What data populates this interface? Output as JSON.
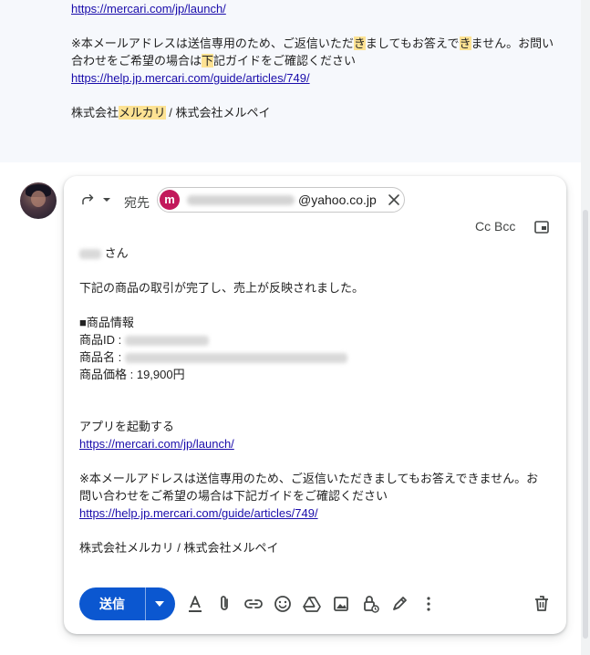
{
  "quoted": {
    "link1": "https://mercari.com/jp/launch/",
    "notice_a": "※本メールアドレスは送信専用のため、ご返信いただ",
    "notice_hl1": "き",
    "notice_b": "ましてもお答えで",
    "notice_hl2": "き",
    "notice_c": "ません。お問い",
    "notice_line2_a": "合わせをご希望の場合は",
    "notice_line2_hl": "下",
    "notice_line2_b": "記ガイドをご確認ください",
    "link2": "https://help.jp.mercari.com/guide/articles/749/",
    "company_a": "株式会社",
    "company_hl": "メルカリ",
    "company_b": " / 株式会社メルペイ"
  },
  "compose": {
    "to_label": "宛先",
    "recipient_initial": "m",
    "recipient_domain": "@yahoo.co.jp",
    "cc_bcc": "Cc Bcc",
    "greeting_suffix": "さん",
    "line_completed": "下記の商品の取引が完了し、売上が反映されました。",
    "product_info_heading": "■商品情報",
    "product_id_label": "商品ID : ",
    "product_name_label": "商品名 : ",
    "product_price": "商品価格 : 19,900円",
    "launch_app": "アプリを起動する",
    "link1": "https://mercari.com/jp/launch/",
    "notice_line1": "※本メールアドレスは送信専用のため、ご返信いただきましてもお答えできません。お",
    "notice_line2": "問い合わせをご希望の場合は下記ガイドをご確認ください",
    "link2": "https://help.jp.mercari.com/guide/articles/749/",
    "company": "株式会社メルカリ / 株式会社メルペイ"
  },
  "toolbar": {
    "send_label": "送信",
    "icons": [
      "formatting-icon",
      "attach-icon",
      "link-icon",
      "emoji-icon",
      "drive-icon",
      "photo-icon",
      "confidential-icon",
      "signature-icon",
      "more-options-icon",
      "discard-icon"
    ]
  },
  "colors": {
    "send_button": "#0b57d0",
    "recipient_avatar": "#c2185b",
    "search_highlight": "#fde293",
    "link": "#1a0dab"
  }
}
